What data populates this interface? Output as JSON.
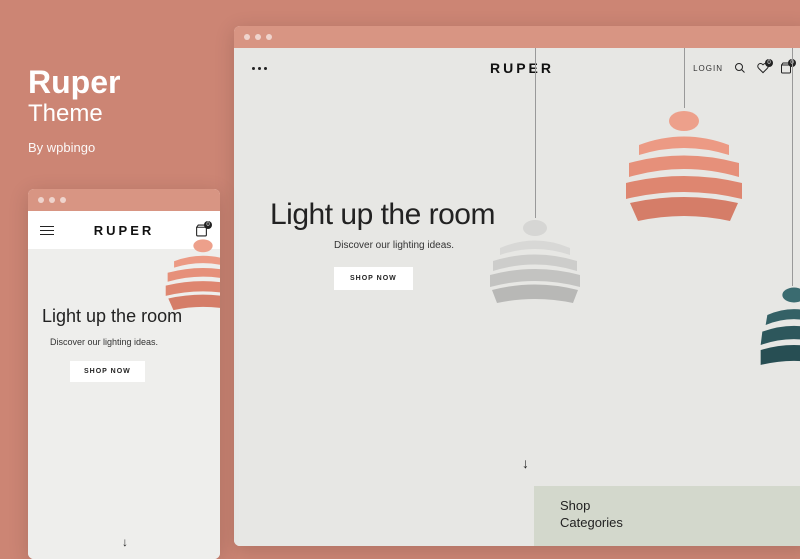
{
  "title": {
    "main": "Ruper",
    "sub": "Theme",
    "author": "By wpbingo"
  },
  "brand": "RUPER",
  "login": "LOGIN",
  "cart_count": "0",
  "wishlist_count": "0",
  "hero": {
    "title": "Light up the room",
    "subtitle": "Discover our lighting ideas.",
    "cta": "SHOP NOW"
  },
  "categories": {
    "title": "Shop Categories"
  },
  "colors": {
    "bg": "#cc8574",
    "bar": "#d89583",
    "hero_bg": "#e7e7e4",
    "cat_bg": "#d3d8cc",
    "lamp_coral": "#e99079",
    "lamp_grey": "#c9c9c7",
    "lamp_teal": "#2d5a5e"
  }
}
